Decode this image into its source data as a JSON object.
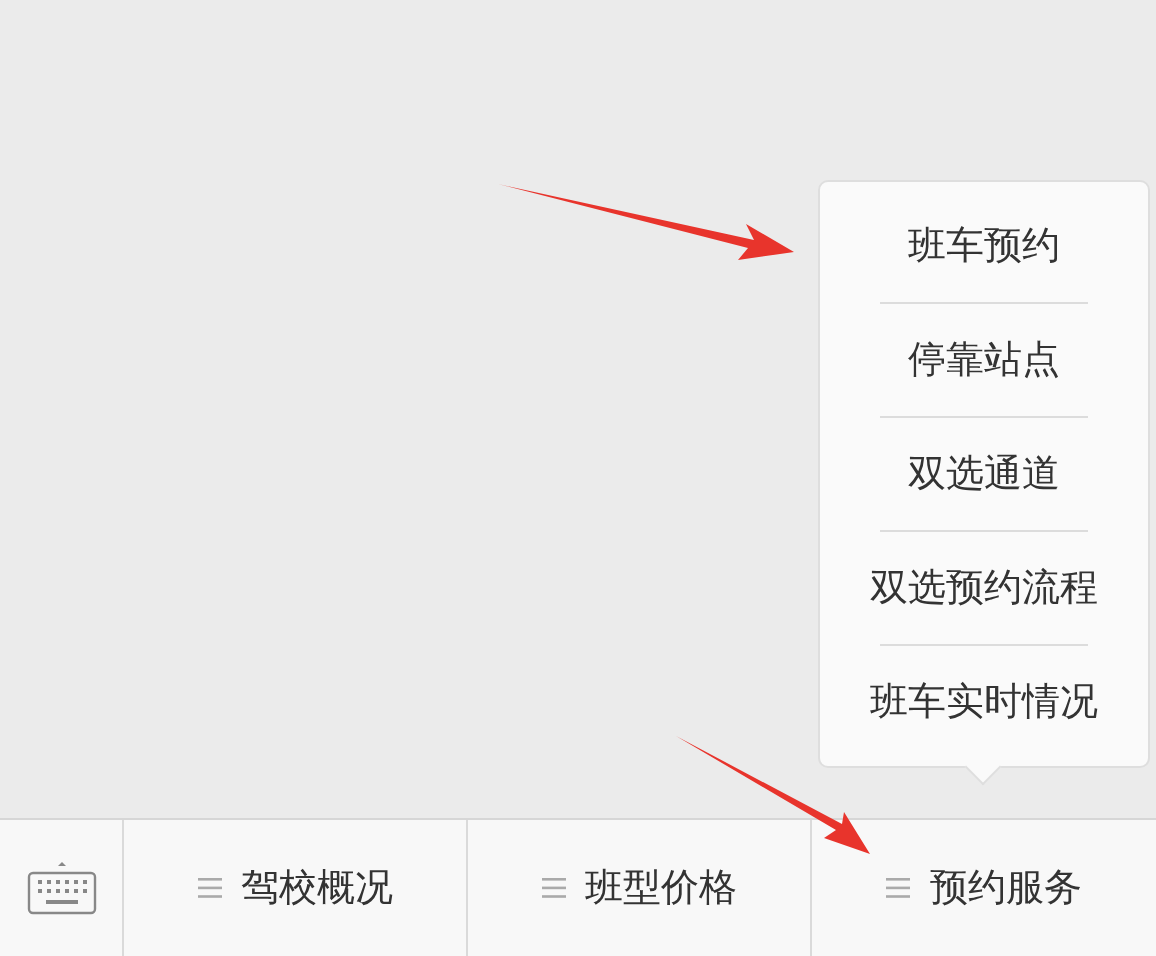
{
  "popup_menu": {
    "items": [
      "班车预约",
      "停靠站点",
      "双选通道",
      "双选预约流程",
      "班车实时情况"
    ]
  },
  "menu_bar": {
    "items": [
      "驾校概况",
      "班型价格",
      "预约服务"
    ]
  }
}
